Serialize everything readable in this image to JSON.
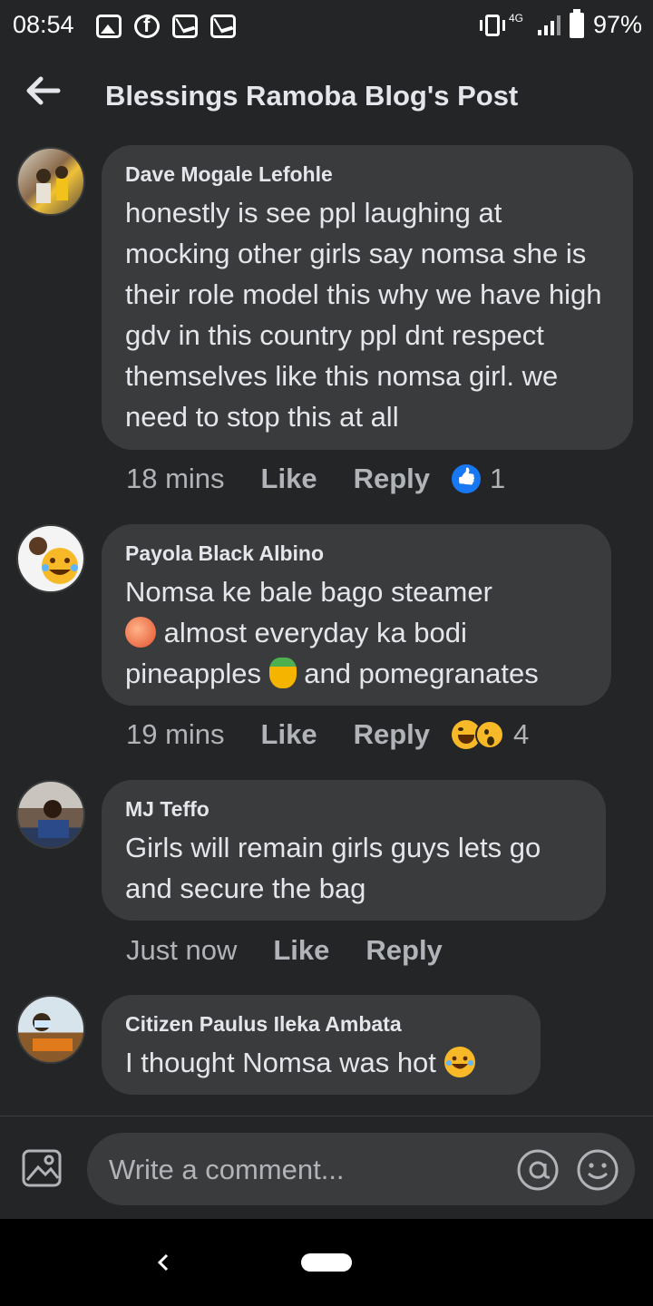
{
  "status_bar": {
    "time": "08:54",
    "network": "4G",
    "battery": "97%"
  },
  "header": {
    "title": "Blessings Ramoba Blog's Post"
  },
  "comments": [
    {
      "author": "Dave Mogale Lefohle",
      "text": "honestly is see ppl laughing at mocking other girls say nomsa she is their role model this why we have high gdv in this country ppl dnt respect themselves like this nomsa girl. we need to stop this at all",
      "time": "18 mins",
      "like_label": "Like",
      "reply_label": "Reply",
      "reactions": [
        "like"
      ],
      "reaction_count": "1"
    },
    {
      "author": "Payola Black Albino",
      "text_parts": [
        "Nomsa ke bale bago steamer",
        "almost everyday ka bodi pineapples",
        "and pomegranates"
      ],
      "emojis": [
        "peach",
        "pineapple"
      ],
      "time": "19 mins",
      "like_label": "Like",
      "reply_label": "Reply",
      "reactions": [
        "haha",
        "wow"
      ],
      "reaction_count": "4"
    },
    {
      "author": "MJ Teffo",
      "text": "Girls will remain girls guys lets go and secure the bag",
      "time": "Just now",
      "like_label": "Like",
      "reply_label": "Reply"
    },
    {
      "author": "Citizen Paulus Ileka Ambata",
      "text": "I thought Nomsa was hot",
      "emojis": [
        "laughing-with-tears"
      ]
    }
  ],
  "composer": {
    "placeholder": "Write a comment..."
  },
  "colors": {
    "background": "#242526",
    "bubble": "#3a3b3c",
    "primary_text": "#e4e6eb",
    "secondary_text": "#b0b3b8",
    "like_blue": "#1877f2",
    "emoji_yellow": "#f7b928"
  }
}
